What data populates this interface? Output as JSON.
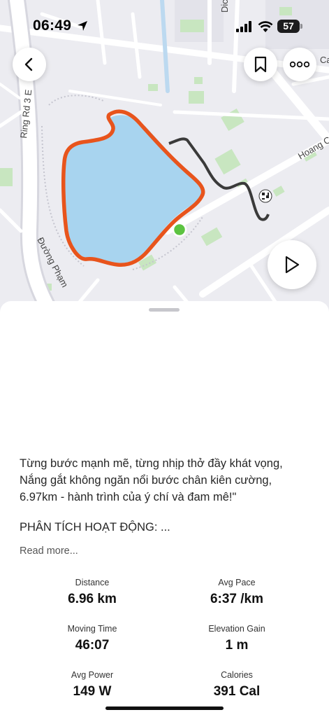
{
  "status_bar": {
    "time": "06:49",
    "battery": "57"
  },
  "map": {
    "labels": {
      "ring_road": "Ring Rd 3 E",
      "street_pham": "Đường Phạm",
      "hoang": "Hoang C",
      "dic": "Dic",
      "ca": "Ca"
    },
    "route_color": "#e8541c",
    "extension_color": "#3a3a3a",
    "water_color": "#a8d4ef",
    "start_marker_color": "#5cc341"
  },
  "buttons": {
    "back": "back-icon",
    "bookmark": "bookmark-icon",
    "more": "more-icon",
    "play": "play-icon"
  },
  "activity": {
    "description": [
      "Từng bước mạnh mẽ, từng nhịp thở đầy khát vọng,",
      "Nắng gắt không ngăn nổi bước chân kiên cường,",
      "6.97km - hành trình của ý chí và đam mê!\""
    ],
    "analysis_title": "PHÂN TÍCH HOẠT ĐỘNG:  ...",
    "read_more": "Read more..."
  },
  "stats": [
    {
      "label": "Distance",
      "value": "6.96 km"
    },
    {
      "label": "Avg Pace",
      "value": "6:37 /km"
    },
    {
      "label": "Moving Time",
      "value": "46:07"
    },
    {
      "label": "Elevation Gain",
      "value": "1 m"
    },
    {
      "label": "Avg Power",
      "value": "149 W"
    },
    {
      "label": "Calories",
      "value": "391 Cal"
    }
  ]
}
